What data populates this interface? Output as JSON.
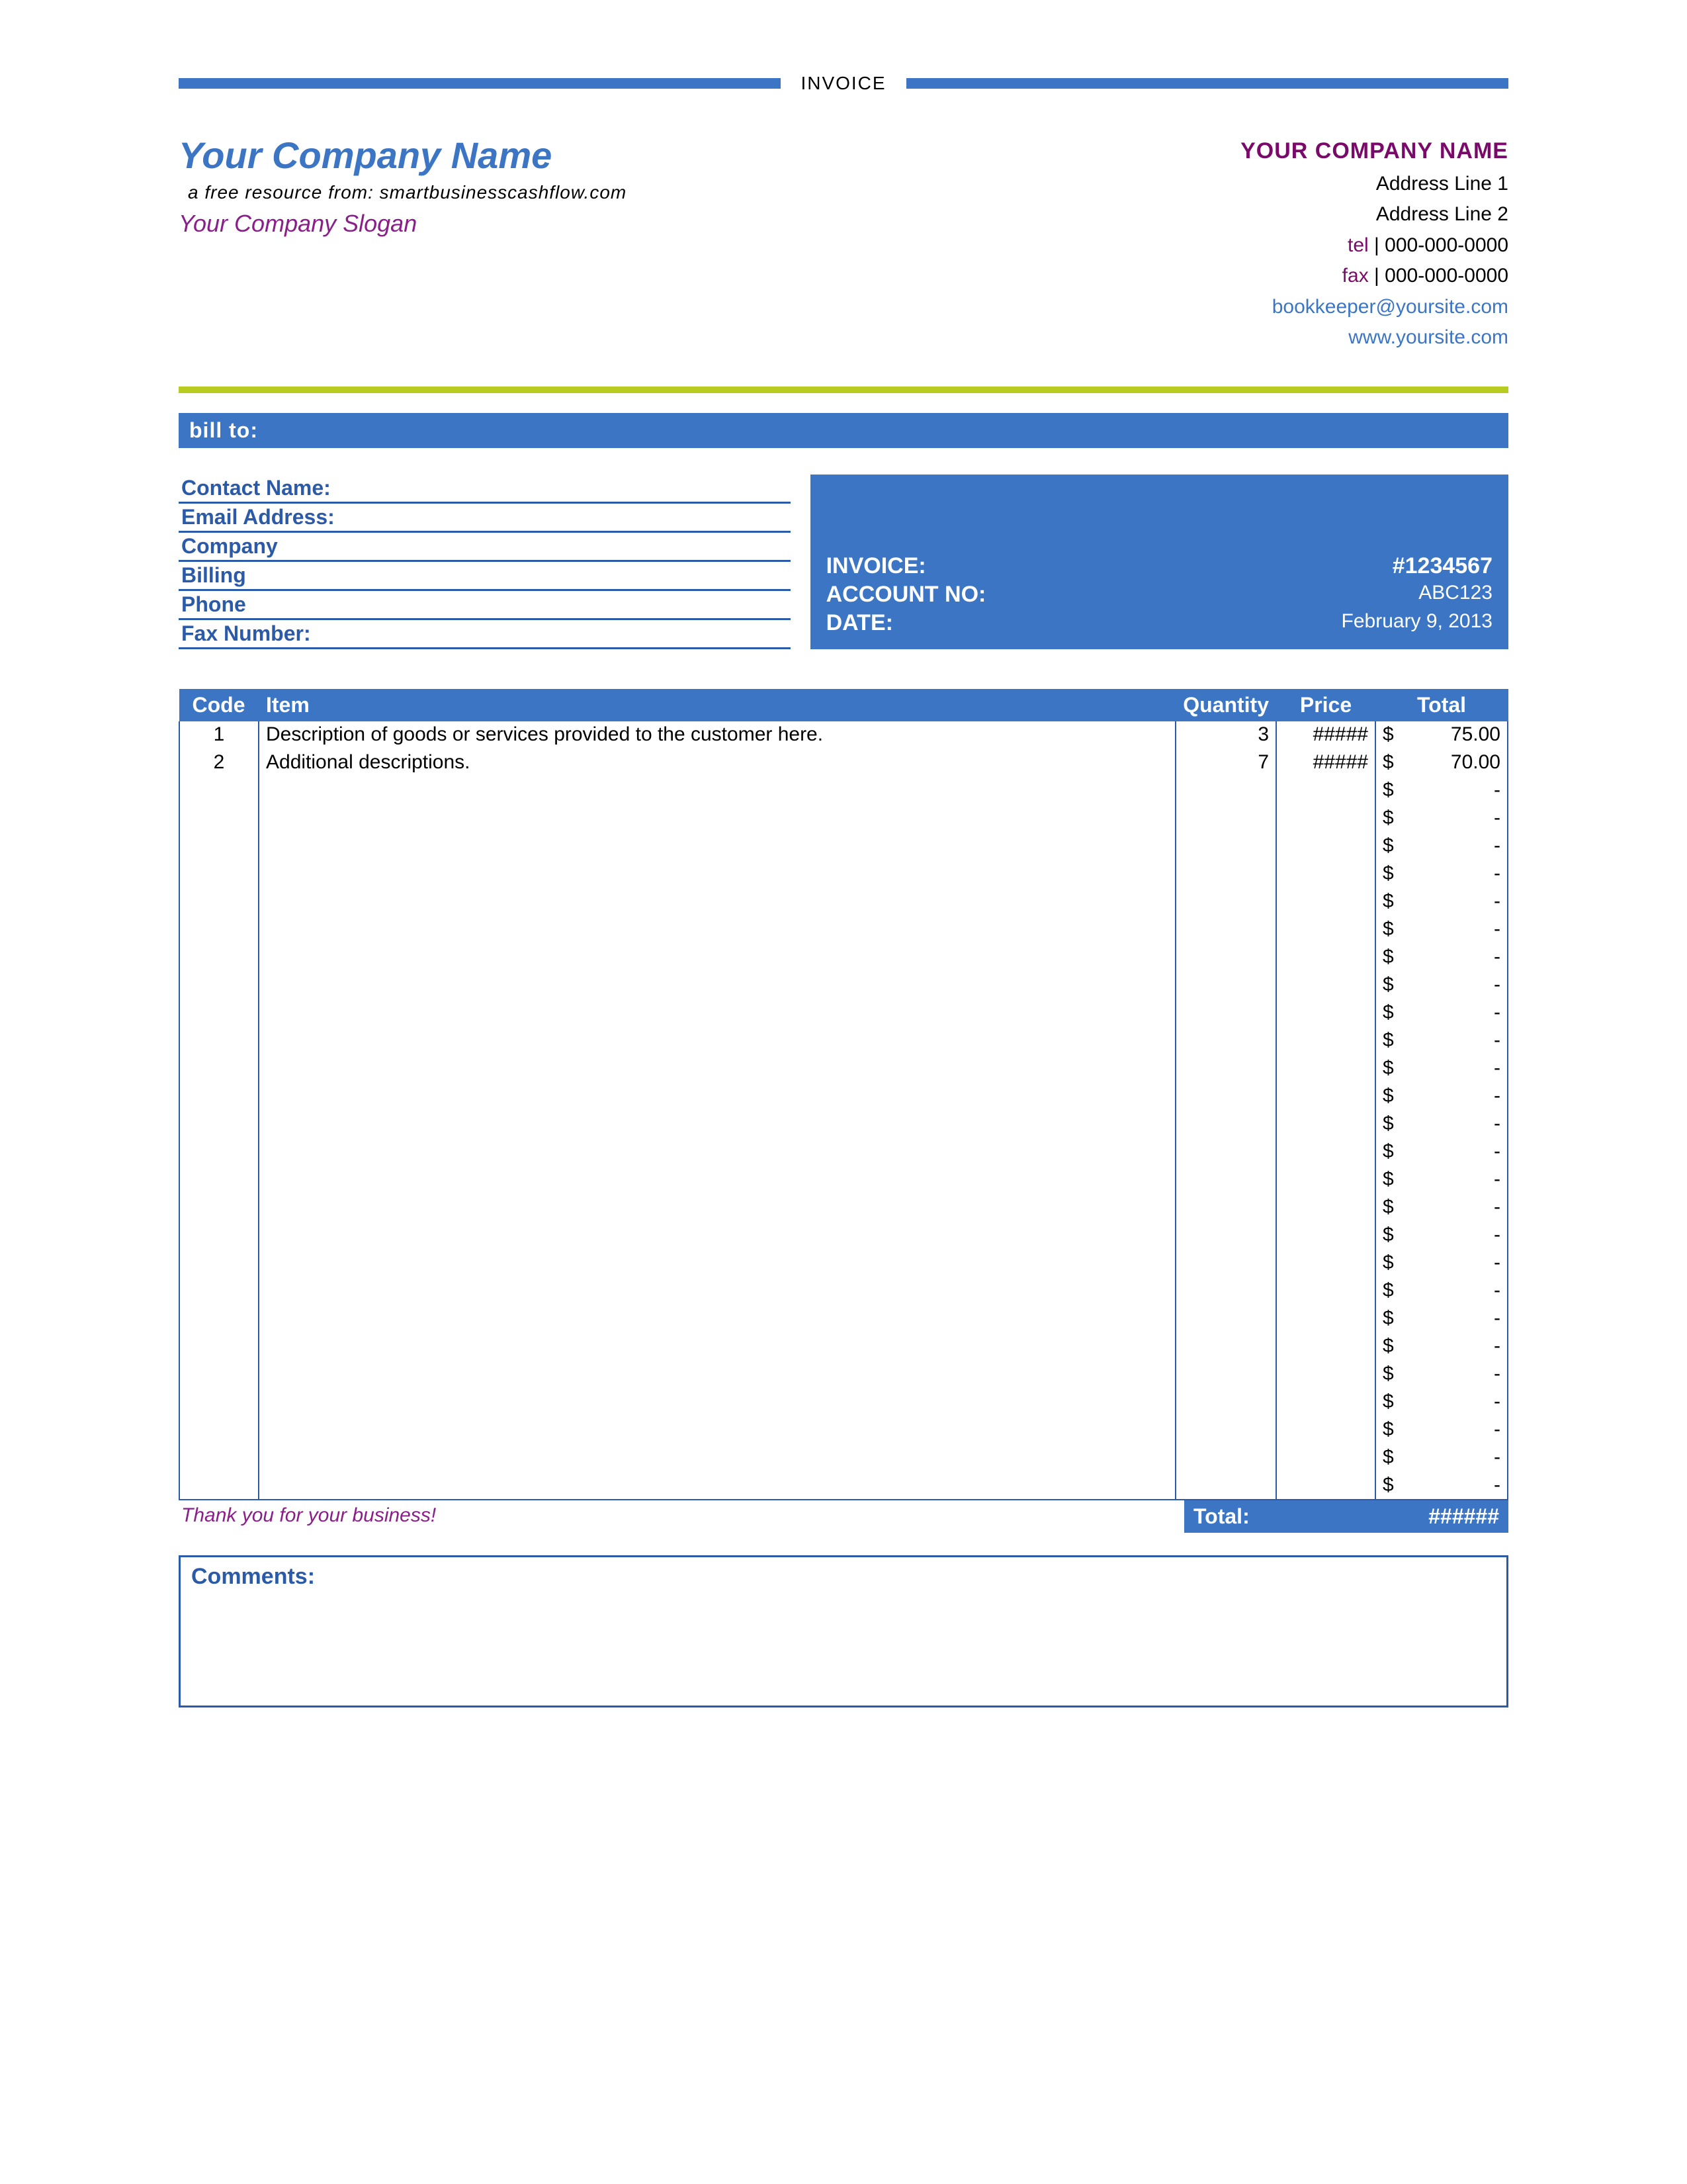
{
  "doc_title": "INVOICE",
  "header": {
    "company_name_left": "Your Company Name",
    "resource_line": "a free resource from: smartbusinesscashflow.com",
    "slogan": "Your Company Slogan",
    "company_name_right": "YOUR COMPANY NAME",
    "address1": "Address Line 1",
    "address2": "Address Line 2",
    "tel_label": "tel",
    "tel": "000-000-0000",
    "fax_label": "fax",
    "fax": "000-000-0000",
    "email": "bookkeeper@yoursite.com",
    "website": "www.yoursite.com"
  },
  "bill_to_label": "bill to:",
  "contact_fields": {
    "name": "Contact Name:",
    "email": "Email Address:",
    "company": "Company",
    "billing": "Billing",
    "phone": "Phone",
    "fax": "Fax Number:"
  },
  "invoice_box": {
    "invoice_label": "INVOICE:",
    "invoice_no": "#1234567",
    "account_label": "ACCOUNT NO:",
    "account_no": "ABC123",
    "date_label": "DATE:",
    "date": "February 9, 2013"
  },
  "table": {
    "headers": {
      "code": "Code",
      "item": "Item",
      "qty": "Quantity",
      "price": "Price",
      "total": "Total"
    },
    "rows": [
      {
        "code": "1",
        "item": "Description of goods or services provided to the customer here.",
        "qty": "3",
        "price": "#####",
        "total": "75.00"
      },
      {
        "code": "2",
        "item": "Additional descriptions.",
        "qty": "7",
        "price": "#####",
        "total": "70.00"
      },
      {
        "code": "",
        "item": "",
        "qty": "",
        "price": "",
        "total": "-"
      },
      {
        "code": "",
        "item": "",
        "qty": "",
        "price": "",
        "total": "-"
      },
      {
        "code": "",
        "item": "",
        "qty": "",
        "price": "",
        "total": "-"
      },
      {
        "code": "",
        "item": "",
        "qty": "",
        "price": "",
        "total": "-"
      },
      {
        "code": "",
        "item": "",
        "qty": "",
        "price": "",
        "total": "-"
      },
      {
        "code": "",
        "item": "",
        "qty": "",
        "price": "",
        "total": "-"
      },
      {
        "code": "",
        "item": "",
        "qty": "",
        "price": "",
        "total": "-"
      },
      {
        "code": "",
        "item": "",
        "qty": "",
        "price": "",
        "total": "-"
      },
      {
        "code": "",
        "item": "",
        "qty": "",
        "price": "",
        "total": "-"
      },
      {
        "code": "",
        "item": "",
        "qty": "",
        "price": "",
        "total": "-"
      },
      {
        "code": "",
        "item": "",
        "qty": "",
        "price": "",
        "total": "-"
      },
      {
        "code": "",
        "item": "",
        "qty": "",
        "price": "",
        "total": "-"
      },
      {
        "code": "",
        "item": "",
        "qty": "",
        "price": "",
        "total": "-"
      },
      {
        "code": "",
        "item": "",
        "qty": "",
        "price": "",
        "total": "-"
      },
      {
        "code": "",
        "item": "",
        "qty": "",
        "price": "",
        "total": "-"
      },
      {
        "code": "",
        "item": "",
        "qty": "",
        "price": "",
        "total": "-"
      },
      {
        "code": "",
        "item": "",
        "qty": "",
        "price": "",
        "total": "-"
      },
      {
        "code": "",
        "item": "",
        "qty": "",
        "price": "",
        "total": "-"
      },
      {
        "code": "",
        "item": "",
        "qty": "",
        "price": "",
        "total": "-"
      },
      {
        "code": "",
        "item": "",
        "qty": "",
        "price": "",
        "total": "-"
      },
      {
        "code": "",
        "item": "",
        "qty": "",
        "price": "",
        "total": "-"
      },
      {
        "code": "",
        "item": "",
        "qty": "",
        "price": "",
        "total": "-"
      },
      {
        "code": "",
        "item": "",
        "qty": "",
        "price": "",
        "total": "-"
      },
      {
        "code": "",
        "item": "",
        "qty": "",
        "price": "",
        "total": "-"
      },
      {
        "code": "",
        "item": "",
        "qty": "",
        "price": "",
        "total": "-"
      },
      {
        "code": "",
        "item": "",
        "qty": "",
        "price": "",
        "total": "-"
      }
    ],
    "currency": "$",
    "total_label": "Total:",
    "total_value": "######"
  },
  "thanks": "Thank you for your business!",
  "comments_label": "Comments:"
}
